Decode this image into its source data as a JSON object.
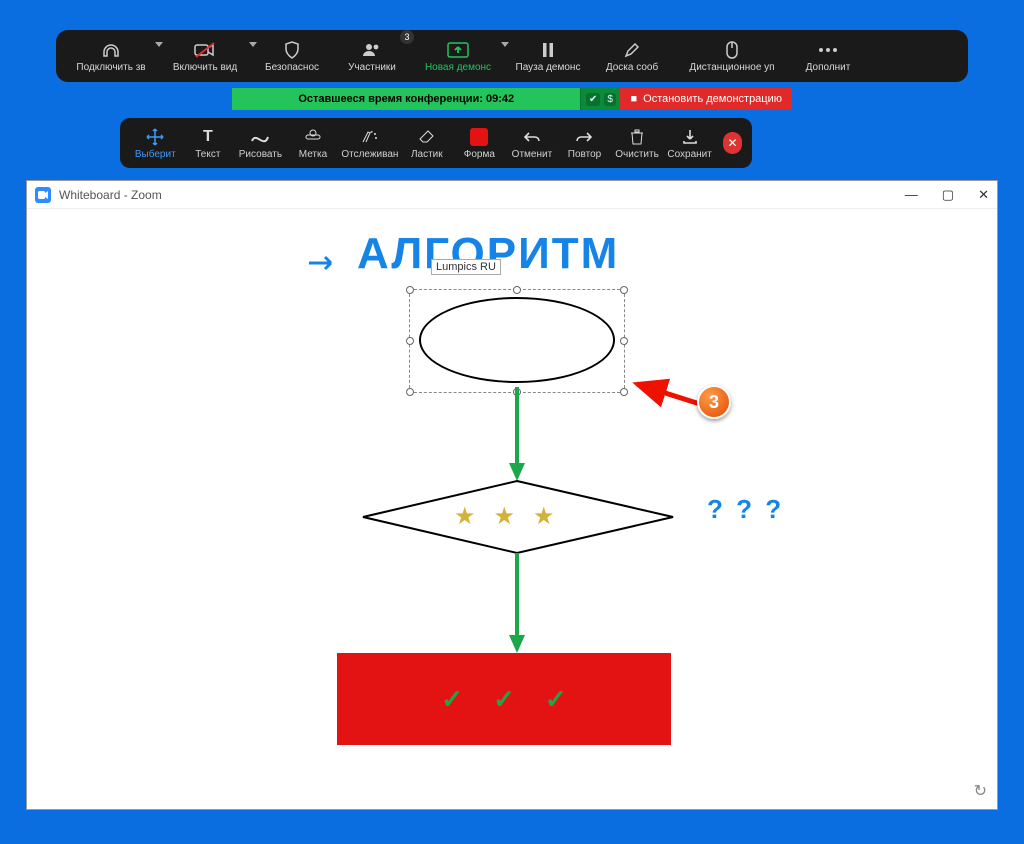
{
  "meeting_toolbar": {
    "audio": "Подключить зв",
    "video": "Включить вид",
    "security": "Безопаснос",
    "participants": "Участники",
    "participants_count": "3",
    "new_share": "Новая демонс",
    "pause_share": "Пауза демонс",
    "whiteboard": "Доска сооб",
    "remote": "Дистанционное уп",
    "more": "Дополнит"
  },
  "status": {
    "time_remaining": "Оставшееся время конференции: 09:42",
    "stop_share": "Остановить демонстрацию"
  },
  "anno": {
    "select": "Выберит",
    "text": "Текст",
    "draw": "Рисовать",
    "stamp": "Метка",
    "spotlight": "Отслеживан",
    "eraser": "Ластик",
    "format": "Форма",
    "undo": "Отменит",
    "redo": "Повтор",
    "clear": "Очистить",
    "save": "Сохранит"
  },
  "window": {
    "title": "Whiteboard - Zoom"
  },
  "whiteboard": {
    "heading": "АЛГОРИТМ",
    "watermark": "Lumpics RU",
    "questions": "? ? ?",
    "callout_number": "3"
  }
}
